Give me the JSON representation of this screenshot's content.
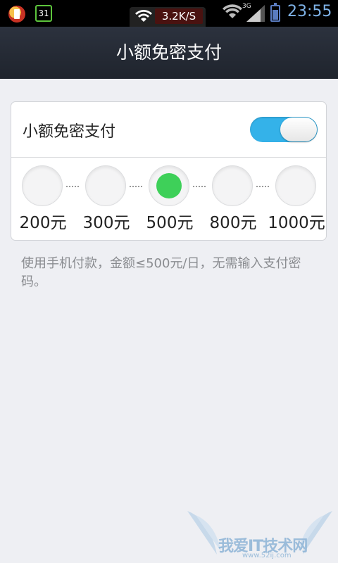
{
  "status_bar": {
    "calendar_day": "31",
    "net_speed": "3.2K/S",
    "network_type": "3G",
    "time": "23:55"
  },
  "header": {
    "title": "小额免密支付"
  },
  "card": {
    "toggle_label": "小额免密支付",
    "toggle_on": true,
    "levels": [
      {
        "label": "200元",
        "selected": false
      },
      {
        "label": "300元",
        "selected": false
      },
      {
        "label": "500元",
        "selected": true
      },
      {
        "label": "800元",
        "selected": false
      },
      {
        "label": "1000元",
        "selected": false
      }
    ]
  },
  "description": "使用手机付款，金额≤500元/日，无需输入支付密码。",
  "watermark": {
    "text": "我爱IT技术网",
    "sub": "www.52ij.com"
  },
  "colors": {
    "toggle_on": "#34b2e9",
    "selected_dot": "#3ed059",
    "header_bg": "#2c323e",
    "page_bg": "#eeeff3"
  }
}
